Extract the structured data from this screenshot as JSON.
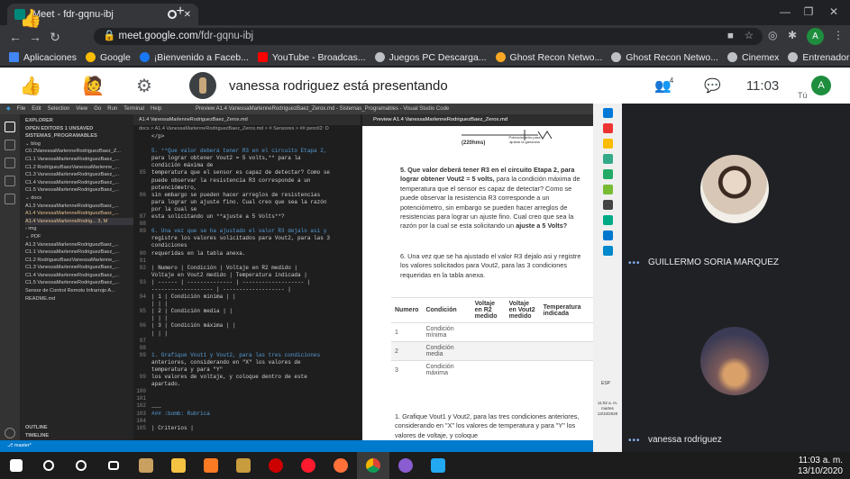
{
  "browser": {
    "tab_title": "Meet - fdr-gqnu-ibj",
    "url_host": "meet.google.com",
    "url_path": "/fdr-gqnu-ibj",
    "profile_initial": "A",
    "bookmarks": [
      {
        "label": "Aplicaciones",
        "icon": "apps-grid-icon"
      },
      {
        "label": "Google",
        "icon": "google-icon"
      },
      {
        "label": "¡Bienvenido a Faceb...",
        "icon": "facebook-icon"
      },
      {
        "label": "YouTube - Broadcas...",
        "icon": "youtube-icon"
      },
      {
        "label": "Juegos PC Descarga...",
        "icon": "globe-icon"
      },
      {
        "label": "Ghost Recon Netwo...",
        "icon": "runner-icon"
      },
      {
        "label": "Ghost Recon Netwo...",
        "icon": "globe-icon"
      },
      {
        "label": "Cinemex",
        "icon": "globe-icon"
      },
      {
        "label": "Entrenador de mate...",
        "icon": "globe-icon"
      }
    ]
  },
  "meet": {
    "presenter_text": "vanessa rodriguez está presentando",
    "participant_count": "4",
    "time": "11:03",
    "you_label": "Tú",
    "self_initial": "A",
    "participants": [
      {
        "name": "GUILLERMO SORIA MARQUEZ"
      },
      {
        "name": "vanessa rodriguez"
      }
    ]
  },
  "vscode": {
    "window_title": "Preview A1.4 VanessaMarlenneRodriguezBaez_Zerox.md - Sistemas_Programables - Visual Studio Code",
    "menu": [
      "File",
      "Edit",
      "Selection",
      "View",
      "Go",
      "Run",
      "Terminal",
      "Help"
    ],
    "sidebar": [
      {
        "text": "EXPLORER",
        "hdr": true
      },
      {
        "text": "OPEN EDITORS  1 UNSAVED",
        "hdr": true
      },
      {
        "text": "SISTEMAS_PROGRAMABLES",
        "hdr": true
      },
      {
        "text": "⌄ blog"
      },
      {
        "text": "  C0.2VanessaMarlenneRodriguezBaez_Z..."
      },
      {
        "text": "  C1.1 VanessaMarlenneRodriguezBaez_..."
      },
      {
        "text": "  C1.2 RodriguezBaezVanessaMarlenne_..."
      },
      {
        "text": "  C1.3 VanessaMarlenneRodriguezBaez_..."
      },
      {
        "text": "  C1.4 VanessaMarlenneRodriguezBaez_..."
      },
      {
        "text": "  C1.5 VanessaMarlenneRodriguezBaez_..."
      },
      {
        "text": "⌄ docs"
      },
      {
        "text": "  A1.3 VanessaMarlenneRodriguezBaez_..."
      },
      {
        "text": "  A1.4 VanessaMarlenneRodriguezBaez_..."
      },
      {
        "text": "  A1.4 VanessaMarlenneRodrig... 3, M"
      },
      {
        "text": "› img"
      },
      {
        "text": "⌄ PDF"
      },
      {
        "text": "  A1.3 VanessaMarlenneRodriguezBaez_..."
      },
      {
        "text": "  C1.1 VanessaMarlenneRodriguezBaez_..."
      },
      {
        "text": "  C1.2 RodriguezBaezVanessaMarlenne_..."
      },
      {
        "text": "  C1.3 VanessaMarlenneRodriguezBaez_..."
      },
      {
        "text": "  C1.4 VanessaMarlenneRodriguezBaez_..."
      },
      {
        "text": "  C1.5 VanessaMarlenneRodriguezBaez_..."
      },
      {
        "text": "  Sensor de Control Remoto Infrarrojo A..."
      },
      {
        "text": "  README.md"
      }
    ],
    "outline_label": "OUTLINE",
    "timeline_label": "TIMELINE",
    "editor_tab": "A1.4 VanessaMarlenneRodriguezBaez_Zerox.md",
    "breadcrumb": "docs > A1.4 VanessaMarlenneRodriguezBaez_Zerox.md > # Sensores > ## pencil2: D",
    "lines": [
      {
        "n": "",
        "t": "</p>"
      },
      {
        "n": "",
        "t": ""
      },
      {
        "n": "",
        "t": "5. **Que valor deberá tener R3 en el circuito Etapa 2,"
      },
      {
        "n": "",
        "t": "para lograr obtener Vout2 = 5 volts,** para la"
      },
      {
        "n": "",
        "t": "condición máxima de"
      },
      {
        "n": "85",
        "t": "temperatura que el sensor es capaz de detectar? Como se"
      },
      {
        "n": "",
        "t": "puede observar la resistencia R3 corresponde a un"
      },
      {
        "n": "",
        "t": "potenciómetro,"
      },
      {
        "n": "86",
        "t": "sin embargo se pueden hacer arreglos de resistencias"
      },
      {
        "n": "",
        "t": "para lograr un ajuste fino.  Cual creo que sea la razón"
      },
      {
        "n": "",
        "t": "por la cual se"
      },
      {
        "n": "87",
        "t": "esta solicitando un **ajuste a 5 Volts**?"
      },
      {
        "n": "88",
        "t": ""
      },
      {
        "n": "89",
        "t": "6. Una vez que se ha ajustado el valor R3 dejalo asi y"
      },
      {
        "n": "",
        "t": "registre los valores solicitados para Vout2, para las 3"
      },
      {
        "n": "",
        "t": "condiciones"
      },
      {
        "n": "90",
        "t": "requeridas en la tabla anexa."
      },
      {
        "n": "91",
        "t": ""
      },
      {
        "n": "92",
        "t": "| Numero | Condición      | Voltaje en R2 medido |"
      },
      {
        "n": "",
        "t": "Voltaje en Vout2 medido | Temperatura indicada |"
      },
      {
        "n": "93",
        "t": "| ------ | -------------- | ------------------- |"
      },
      {
        "n": "",
        "t": "------------------- | ------------------- |"
      },
      {
        "n": "94",
        "t": "| 1      | Condición mínima |                    |"
      },
      {
        "n": "",
        "t": "|                 |                    |"
      },
      {
        "n": "95",
        "t": "| 2      | Condición media  |                    |"
      },
      {
        "n": "",
        "t": "|                 |                    |"
      },
      {
        "n": "96",
        "t": "| 3      | Condición máxima |                    |"
      },
      {
        "n": "",
        "t": "|                 |                    |"
      },
      {
        "n": "97",
        "t": ""
      },
      {
        "n": "98",
        "t": ""
      },
      {
        "n": "99",
        "t": "1. Grafique Vout1 y Vout2, para las tres condiciones"
      },
      {
        "n": "",
        "t": "anteriores, considerando en \"X\" los valores de"
      },
      {
        "n": "",
        "t": "temperatura y para \"Y\""
      },
      {
        "n": "99",
        "t": "los valores de voltaje, y coloque dentro de este"
      },
      {
        "n": "",
        "t": "apartado."
      },
      {
        "n": "100",
        "t": ""
      },
      {
        "n": "101",
        "t": ""
      },
      {
        "n": "102",
        "t": "___"
      },
      {
        "n": "103",
        "t": "### :bomb: Rubrica"
      },
      {
        "n": "104",
        "t": ""
      },
      {
        "n": "105",
        "t": "| Criterios     |"
      }
    ],
    "preview_tab": "Preview A1.4 VanessaMarlenneRodriguezBaez_Zerox.md",
    "circuit_label": "(220hms)",
    "circuit_caption": "Potenciometro para ajustar la ganancia",
    "q5_bold1": "5. Que valor deberá tener R3 en el circuito Etapa 2, para lograr obtener Vout2 = 5 volts,",
    "q5_text": " para la condición máxima de temperatura que el sensor es capaz de detectar? Como se puede observar la resistencia R3 corresponde a un potenciómetro, sin embargo se pueden hacer arreglos de resistencias para lograr un ajuste fino. Cual creo que sea la razón por la cual se esta solicitando un ",
    "q5_bold2": "ajuste a 5 Volts?",
    "q6": "6. Una vez que se ha ajustado el valor R3 dejalo asi y registre los valores solicitados para Vout2, para las 3 condiciones requeridas en la tabla anexa.",
    "table_headers": [
      "Numero",
      "Condición",
      "Voltaje en R2 medido",
      "Voltaje en Vout2 medido",
      "Temperatura indicada"
    ],
    "table_rows": [
      [
        "1",
        "Condición mínima"
      ],
      [
        "2",
        "Condición media"
      ],
      [
        "3",
        "Condición máxima"
      ]
    ],
    "q7": "1. Grafique Vout1 y Vout2, para las tres condiciones anteriores, considerando en \"X\" los valores de temperatura y para \"Y\" los valores de voltaje, y coloque",
    "status_branch": "master*",
    "win_clock_time": "11:02 a. m.",
    "win_clock_day": "martes",
    "win_clock_date": "13/10/2020",
    "win_lang": "ESP"
  },
  "taskbar": {
    "time": "11:03 a. m.",
    "date": "13/10/2020",
    "apps": [
      "start-icon",
      "search-icon",
      "cortana-icon",
      "task-view-icon",
      "app-icon",
      "file-explorer-icon",
      "xampp-icon",
      "league-icon",
      "game-icon",
      "opera-icon",
      "firefox-icon",
      "chrome-icon",
      "github-icon",
      "vscode-icon"
    ]
  }
}
